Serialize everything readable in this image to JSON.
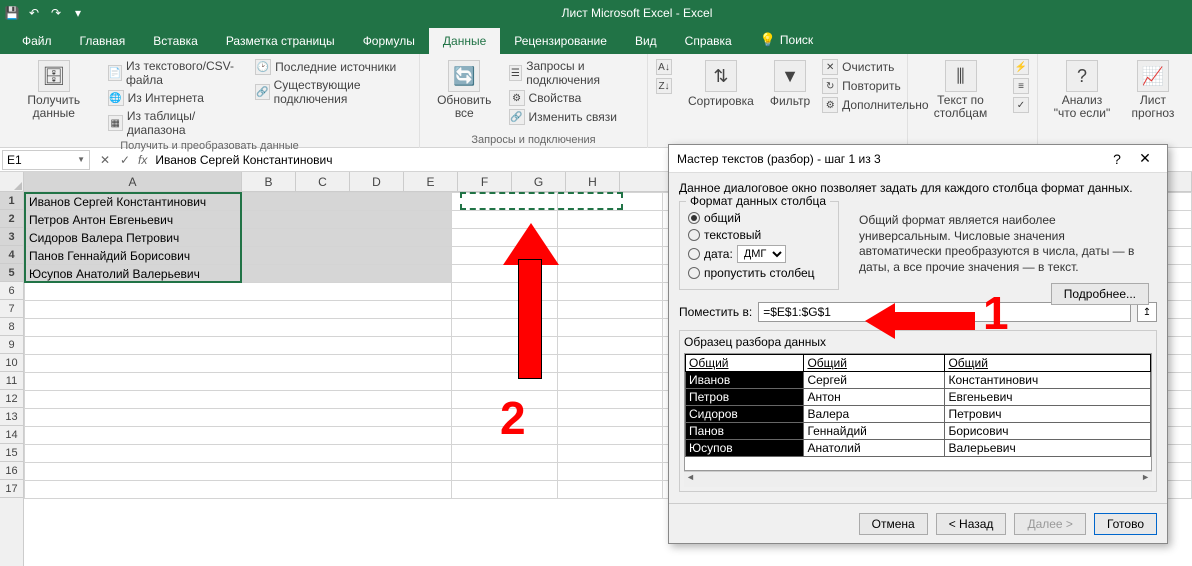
{
  "title": "Лист Microsoft Excel  -  Excel",
  "tabs": [
    "Файл",
    "Главная",
    "Вставка",
    "Разметка страницы",
    "Формулы",
    "Данные",
    "Рецензирование",
    "Вид",
    "Справка"
  ],
  "search_placeholder": "Поиск",
  "ribbon": {
    "group1": {
      "big": "Получить данные",
      "items": [
        "Из текстового/CSV-файла",
        "Из Интернета",
        "Из таблицы/диапазона",
        "Последние источники",
        "Существующие подключения"
      ],
      "label": "Получить и преобразовать данные"
    },
    "group2": {
      "big": "Обновить все",
      "items": [
        "Запросы и подключения",
        "Свойства",
        "Изменить связи"
      ],
      "label": "Запросы и подключения"
    },
    "group3": {
      "sort": "Сортировка",
      "filter": "Фильтр",
      "clear": "Очистить",
      "reapply": "Повторить",
      "adv": "Дополнительно"
    },
    "group4": {
      "text": "Текст по столбцам"
    },
    "group5": {
      "whatif": "Анализ \"что если\"",
      "forecast": "Лист прогноз"
    }
  },
  "namebox": "E1",
  "formula": "Иванов Сергей Константинович",
  "cols": [
    "A",
    "B",
    "C",
    "D",
    "E",
    "F",
    "G",
    "H"
  ],
  "rows_shown": 17,
  "data_rows": [
    "Иванов Сергей Константинович",
    "Петров Антон Евгеньевич",
    "Сидоров Валера Петрович",
    "Панов Геннайдий Борисович",
    "Юсупов Анатолий Валерьевич"
  ],
  "dialog": {
    "title": "Мастер текстов (разбор) - шаг 1 из 3",
    "intro": "Данное диалоговое окно позволяет задать для каждого столбца формат данных.",
    "groupbox": "Формат данных столбца",
    "radios": {
      "general": "общий",
      "text": "текстовый",
      "date": "дата:",
      "skip": "пропустить столбец"
    },
    "date_format": "ДМГ",
    "help_text": "Общий формат является наиболее универсальным. Числовые значения автоматически преобразуются в числа, даты — в даты, а все прочие значения — в текст.",
    "details_btn": "Подробнее...",
    "dest_label": "Поместить в:",
    "dest_value": "=$E$1:$G$1",
    "preview_label": "Образец разбора данных",
    "preview_headers": [
      "Общий",
      "Общий",
      "Общий"
    ],
    "preview_rows": [
      [
        "Иванов",
        "Сергей",
        "Константинович"
      ],
      [
        "Петров",
        "Антон",
        "Евгеньевич"
      ],
      [
        "Сидоров",
        "Валера",
        "Петрович"
      ],
      [
        "Панов",
        "Геннайдий",
        "Борисович"
      ],
      [
        "Юсупов",
        "Анатолий",
        "Валерьевич"
      ]
    ],
    "buttons": {
      "cancel": "Отмена",
      "back": "< Назад",
      "next": "Далее >",
      "finish": "Готово"
    }
  },
  "annotations": {
    "one": "1",
    "two": "2"
  }
}
